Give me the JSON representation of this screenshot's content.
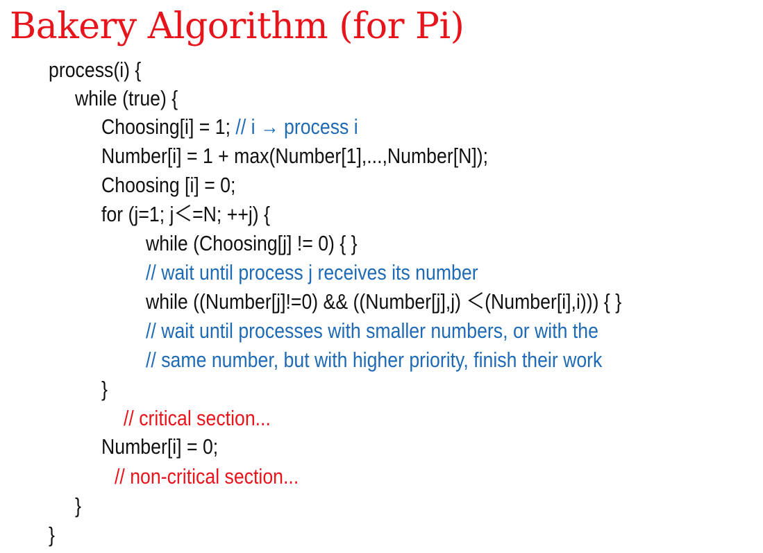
{
  "title": "Bakery Algorithm (for Pi)",
  "colors": {
    "title": "#e8141c",
    "code": "#111111",
    "comment_blue": "#1f6ab5",
    "comment_red": "#e8141c"
  },
  "code": {
    "l1": "process(i) {",
    "l2": "while (true) {",
    "l3_code": "Choosing[i] = 1; ",
    "l3_comment": "// i → process i",
    "l4": "Number[i] = 1 + max(Number[1],...,Number[N]);",
    "l5": "Choosing [i] = 0;",
    "l6": "for (j=1; j＜=N; ++j) {",
    "l7": "while (Choosing[j] != 0)  { }",
    "l8": "// wait until process j receives its number",
    "l9": "while ((Number[j]!=0) && ((Number[j],j) ＜(Number[i],i))) { }",
    "l10": "// wait until processes with smaller numbers, or with the",
    "l11": "// same number, but with higher priority, finish their work",
    "l12": "}",
    "l13": "// critical section...",
    "l14": "Number[i] = 0;",
    "l15": "// non-critical section...",
    "l16": "}",
    "l17": "}"
  }
}
